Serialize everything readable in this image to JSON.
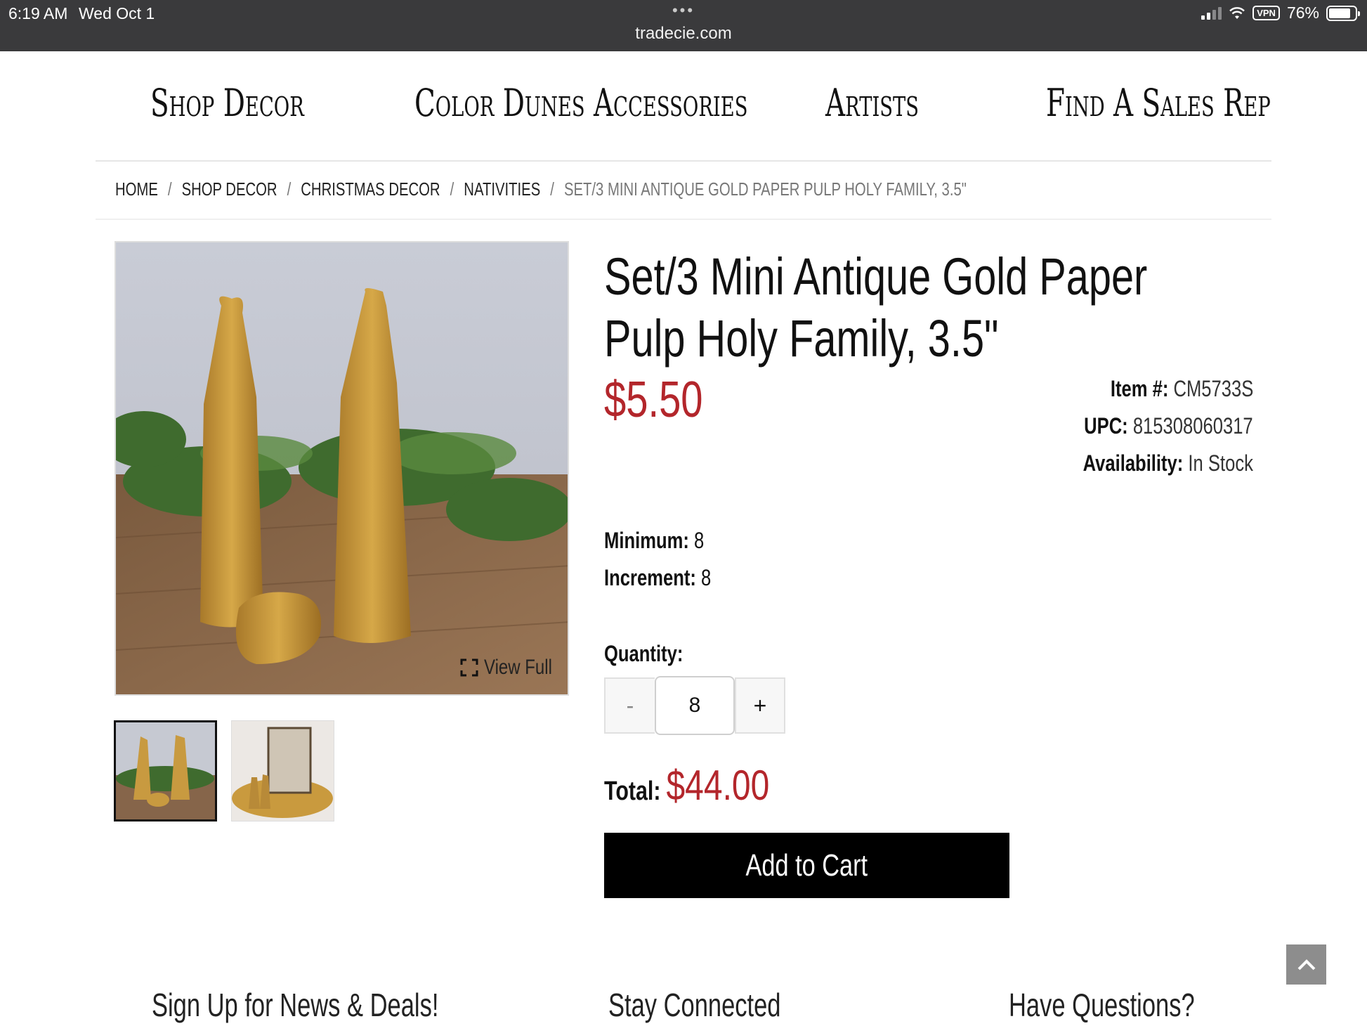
{
  "status_bar": {
    "time": "6:19 AM",
    "date": "Wed Oct 1",
    "dots": "•••",
    "url": "tradecie.com",
    "vpn": "VPN",
    "battery": "76%"
  },
  "nav": {
    "items": [
      {
        "label": "Shop Decor"
      },
      {
        "label": "Color Dunes Accessories"
      },
      {
        "label": "Artists"
      },
      {
        "label": "Find A Sales Rep"
      }
    ]
  },
  "breadcrumb": {
    "separator": "/",
    "items": [
      "HOME",
      "SHOP DECOR",
      "CHRISTMAS DECOR",
      "NATIVITIES"
    ],
    "current": "SET/3 MINI ANTIQUE GOLD PAPER PULP HOLY FAMILY, 3.5\""
  },
  "product": {
    "title": "Set/3 Mini Antique Gold Paper Pulp Holy Family, 3.5\"",
    "price": "$5.50",
    "item_label": "Item #:",
    "item_value": "CM5733S",
    "upc_label": "UPC:",
    "upc_value": "815308060317",
    "availability_label": "Availability:",
    "availability_value": "In Stock",
    "minimum_label": "Minimum:",
    "minimum_value": "8",
    "increment_label": "Increment:",
    "increment_value": "8",
    "quantity_label": "Quantity:",
    "quantity_minus": "-",
    "quantity_value": "8",
    "quantity_plus": "+",
    "total_label": "Total:",
    "total_value": "$44.00",
    "add_to_cart": "Add to Cart",
    "view_full": "View Full"
  },
  "footer": {
    "headings": [
      "Sign Up for News & Deals!",
      "Stay Connected",
      "Have Questions?"
    ]
  },
  "colors": {
    "price_red": "#b3262b",
    "status_bar": "#3a3a3c",
    "button_black": "#000000",
    "to_top_gray": "#8d8d8d"
  }
}
